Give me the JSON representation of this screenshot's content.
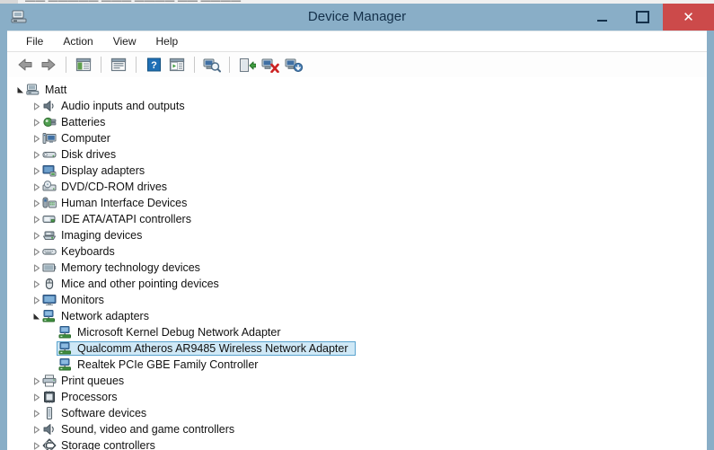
{
  "window": {
    "title": "Device Manager",
    "icon": "device-manager-icon",
    "controls": {
      "minimize": "minimize-button",
      "maximize": "maximize-button",
      "close_label": "✕"
    },
    "colors": {
      "titlebar": "#89aec7",
      "title_text": "#14304a",
      "close_button": "#cc4a4a",
      "selection_fill": "#cfe8f6",
      "selection_border": "#5ba4cf"
    }
  },
  "menubar": {
    "items": [
      {
        "label": "File",
        "name": "menu-file"
      },
      {
        "label": "Action",
        "name": "menu-action"
      },
      {
        "label": "View",
        "name": "menu-view"
      },
      {
        "label": "Help",
        "name": "menu-help"
      }
    ]
  },
  "toolbar": {
    "buttons": [
      {
        "name": "back-icon",
        "title": "Back"
      },
      {
        "name": "forward-icon",
        "title": "Forward"
      },
      {
        "sep": true
      },
      {
        "name": "show-hide-console-tree-icon",
        "title": "Show/Hide Console Tree"
      },
      {
        "sep": true
      },
      {
        "name": "properties-icon",
        "title": "Properties"
      },
      {
        "sep": true
      },
      {
        "name": "help-icon",
        "title": "Help"
      },
      {
        "name": "scan-view-icon",
        "title": "View"
      },
      {
        "sep": true
      },
      {
        "name": "scan-for-hardware-changes-icon",
        "title": "Scan for hardware changes"
      },
      {
        "sep": true
      },
      {
        "name": "update-driver-icon",
        "title": "Update Driver Software"
      },
      {
        "name": "uninstall-device-icon",
        "title": "Uninstall"
      },
      {
        "name": "disable-device-icon",
        "title": "Disable"
      }
    ]
  },
  "tree": {
    "rows": [
      {
        "label": "Matt",
        "depth": 0,
        "state": "expanded",
        "icon": "computer-root-icon",
        "selected": false
      },
      {
        "label": "Audio inputs and outputs",
        "depth": 1,
        "state": "collapsed",
        "icon": "speaker-icon",
        "selected": false
      },
      {
        "label": "Batteries",
        "depth": 1,
        "state": "collapsed",
        "icon": "battery-icon",
        "selected": false
      },
      {
        "label": "Computer",
        "depth": 1,
        "state": "collapsed",
        "icon": "computer-icon",
        "selected": false
      },
      {
        "label": "Disk drives",
        "depth": 1,
        "state": "collapsed",
        "icon": "disk-drive-icon",
        "selected": false
      },
      {
        "label": "Display adapters",
        "depth": 1,
        "state": "collapsed",
        "icon": "display-adapter-icon",
        "selected": false
      },
      {
        "label": "DVD/CD-ROM drives",
        "depth": 1,
        "state": "collapsed",
        "icon": "dvd-drive-icon",
        "selected": false
      },
      {
        "label": "Human Interface Devices",
        "depth": 1,
        "state": "collapsed",
        "icon": "hid-icon",
        "selected": false
      },
      {
        "label": "IDE ATA/ATAPI controllers",
        "depth": 1,
        "state": "collapsed",
        "icon": "ide-controller-icon",
        "selected": false
      },
      {
        "label": "Imaging devices",
        "depth": 1,
        "state": "collapsed",
        "icon": "imaging-device-icon",
        "selected": false
      },
      {
        "label": "Keyboards",
        "depth": 1,
        "state": "collapsed",
        "icon": "keyboard-icon",
        "selected": false
      },
      {
        "label": "Memory technology devices",
        "depth": 1,
        "state": "collapsed",
        "icon": "memory-device-icon",
        "selected": false
      },
      {
        "label": "Mice and other pointing devices",
        "depth": 1,
        "state": "collapsed",
        "icon": "mouse-icon",
        "selected": false
      },
      {
        "label": "Monitors",
        "depth": 1,
        "state": "collapsed",
        "icon": "monitor-icon",
        "selected": false
      },
      {
        "label": "Network adapters",
        "depth": 1,
        "state": "expanded",
        "icon": "network-adapter-icon",
        "selected": false
      },
      {
        "label": "Microsoft Kernel Debug Network Adapter",
        "depth": 2,
        "state": "leaf",
        "icon": "network-adapter-icon",
        "selected": false
      },
      {
        "label": "Qualcomm Atheros AR9485 Wireless Network Adapter",
        "depth": 2,
        "state": "leaf",
        "icon": "network-adapter-icon",
        "selected": true
      },
      {
        "label": "Realtek PCIe GBE Family Controller",
        "depth": 2,
        "state": "leaf",
        "icon": "network-adapter-icon",
        "selected": false
      },
      {
        "label": "Print queues",
        "depth": 1,
        "state": "collapsed",
        "icon": "printer-icon",
        "selected": false
      },
      {
        "label": "Processors",
        "depth": 1,
        "state": "collapsed",
        "icon": "processor-icon",
        "selected": false
      },
      {
        "label": "Software devices",
        "depth": 1,
        "state": "collapsed",
        "icon": "software-device-icon",
        "selected": false
      },
      {
        "label": "Sound, video and game controllers",
        "depth": 1,
        "state": "collapsed",
        "icon": "sound-controller-icon",
        "selected": false
      },
      {
        "label": "Storage controllers",
        "depth": 1,
        "state": "collapsed",
        "icon": "storage-controller-icon",
        "selected": false
      }
    ]
  },
  "background_window": {
    "text": "—— ————— ——— ———— —— ————"
  }
}
